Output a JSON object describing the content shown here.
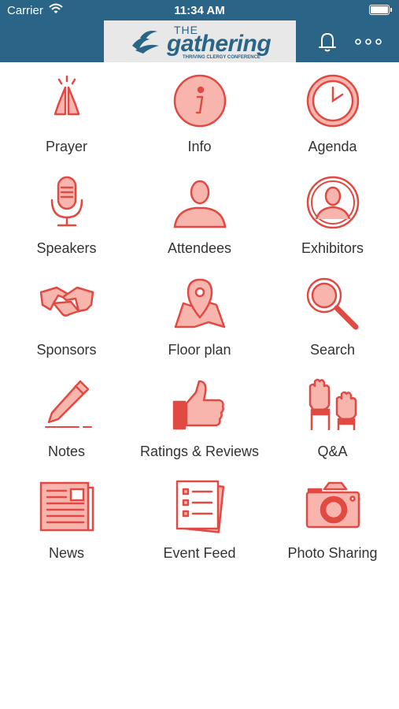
{
  "status_bar": {
    "carrier": "Carrier",
    "time": "11:34 AM"
  },
  "header": {
    "logo": {
      "the": "THE",
      "name": "gathering",
      "tagline": "THRIVING CLERGY CONFERENCE"
    },
    "icons": [
      "bell-icon",
      "more-icon"
    ]
  },
  "colors": {
    "header": "#2a6487",
    "icon_stroke": "#e04a43",
    "icon_fill": "#f7b5ae",
    "label": "#333333"
  },
  "menu": [
    {
      "label": "Prayer",
      "icon": "praying-hands-icon"
    },
    {
      "label": "Info",
      "icon": "info-icon"
    },
    {
      "label": "Agenda",
      "icon": "clock-icon"
    },
    {
      "label": "Speakers",
      "icon": "microphone-icon"
    },
    {
      "label": "Attendees",
      "icon": "person-icon"
    },
    {
      "label": "Exhibitors",
      "icon": "person-circle-icon"
    },
    {
      "label": "Sponsors",
      "icon": "handshake-icon"
    },
    {
      "label": "Floor plan",
      "icon": "map-pin-icon"
    },
    {
      "label": "Search",
      "icon": "magnifier-icon"
    },
    {
      "label": "Notes",
      "icon": "pen-icon"
    },
    {
      "label": "Ratings & Reviews",
      "icon": "thumbs-up-icon"
    },
    {
      "label": "Q&A",
      "icon": "raised-hands-icon"
    },
    {
      "label": "News",
      "icon": "newspaper-icon"
    },
    {
      "label": "Event Feed",
      "icon": "checklist-icon"
    },
    {
      "label": "Photo Sharing",
      "icon": "camera-icon"
    }
  ]
}
